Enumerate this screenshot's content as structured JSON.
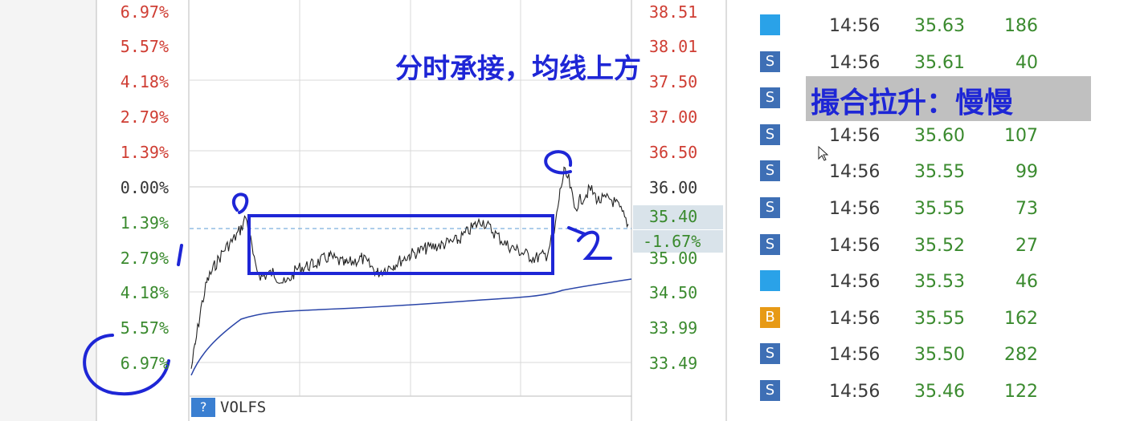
{
  "left_axis_pct": [
    "6.97%",
    "5.57%",
    "4.18%",
    "2.79%",
    "1.39%",
    "0.00%",
    "1.39%",
    "2.79%",
    "4.18%",
    "5.57%",
    "6.97%"
  ],
  "right_axis_price": [
    "38.51",
    "38.01",
    "37.50",
    "37.00",
    "36.50",
    "36.00",
    "35.00",
    "34.50",
    "33.99",
    "33.49"
  ],
  "last_price": "35.40",
  "change_pct": "-1.67%",
  "indicator": {
    "help_label": "?",
    "name": "VOLFS"
  },
  "annotations": {
    "title_note": "分时承接，均线上方",
    "box_note": "撮合拉升：慢慢",
    "mark_1": "1",
    "mark_2": "2"
  },
  "colors": {
    "up": "#cf3d33",
    "down": "#3a8a2e",
    "avg_line": "#2a45a8",
    "annotation": "#1e26d6",
    "sell_badge": "#3e6fb5",
    "buy_badge": "#e79a16",
    "neutral_badge": "#2aa2e8"
  },
  "trades": [
    {
      "side": "",
      "time": "14:56",
      "price": "35.63",
      "vol": "186"
    },
    {
      "side": "S",
      "time": "14:56",
      "price": "35.61",
      "vol": "40"
    },
    {
      "side": "S",
      "time": "",
      "price": "",
      "vol": ""
    },
    {
      "side": "S",
      "time": "14:56",
      "price": "35.60",
      "vol": "107"
    },
    {
      "side": "S",
      "time": "14:56",
      "price": "35.55",
      "vol": "99"
    },
    {
      "side": "S",
      "time": "14:56",
      "price": "35.55",
      "vol": "73"
    },
    {
      "side": "S",
      "time": "14:56",
      "price": "35.52",
      "vol": "27"
    },
    {
      "side": "",
      "time": "14:56",
      "price": "35.53",
      "vol": "46"
    },
    {
      "side": "B",
      "time": "14:56",
      "price": "35.55",
      "vol": "162"
    },
    {
      "side": "S",
      "time": "14:56",
      "price": "35.50",
      "vol": "282"
    },
    {
      "side": "S",
      "time": "14:56",
      "price": "35.46",
      "vol": "122"
    }
  ]
}
